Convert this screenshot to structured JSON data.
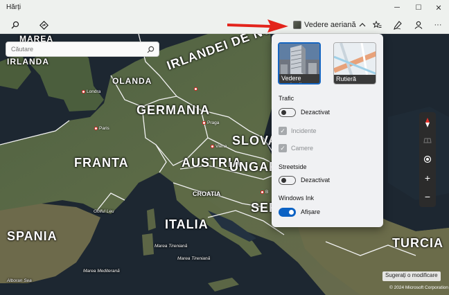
{
  "app": {
    "title": "Hărți"
  },
  "window": {
    "minimize": "─",
    "maximize": "☐",
    "close": "✕"
  },
  "toolbar": {
    "search_icon": "search-icon",
    "directions_icon": "directions-icon",
    "map_style_label": "Vedere aeriană",
    "favorites_icon": "favorites-icon",
    "ink_icon": "pen-icon",
    "account_icon": "person-icon",
    "more_label": "···"
  },
  "search": {
    "placeholder": "Căutare"
  },
  "map": {
    "countries": [
      "GERMANIA",
      "FRANTA",
      "ITALIA",
      "SPANIA",
      "AUSTRIA",
      "UNGARIA",
      "SLOVACIA",
      "CROATIA",
      "SERBIA",
      "TURCIA",
      "OLANDA",
      "IRLANDA",
      "MAREA NORDULUI",
      "MAREA IRLANDEI DE NORD"
    ],
    "countries_text": {
      "germania": "GERMANIA",
      "franta": "FRANTA",
      "italia": "ITALIA",
      "spania": "SPANIA",
      "austria": "AUSTRIA",
      "ungaria": "UNGARIA",
      "slovacia": "SLOVAC",
      "croatia": "CROATIA",
      "serbia": "SER",
      "turcia": "TURCIA",
      "olanda": "OLANDA",
      "irlanda": "IRLANDA",
      "marea_nordului": "MAREA",
      "irlandei_de_nord": "IRLANDEI DE NORD"
    },
    "cities": {
      "londra": "Londra",
      "paris": "Paris",
      "praga": "Praga",
      "viena": "Viena",
      "b": "B"
    },
    "seas": {
      "tirenian1": "Marea Tireniană",
      "tirenian2": "Marea Tireniană",
      "mediterana": "Marea Mediterană",
      "leu": "Golful Leu",
      "alboran": "Alboran Sea"
    }
  },
  "flyout": {
    "tiles": {
      "aerial": "Vedere aeriană",
      "road": "Rutieră"
    },
    "traffic": {
      "title": "Trafic",
      "toggle": "Dezactivat",
      "incidents": "Incidente",
      "cameras": "Camere"
    },
    "streetside": {
      "title": "Streetside",
      "toggle": "Dezactivat"
    },
    "ink": {
      "title": "Windows Ink",
      "toggle": "Afișare"
    }
  },
  "controls": {
    "compass": "compass-icon",
    "tilt": "tilt-icon",
    "locate": "locate-icon",
    "zoom_in": "+",
    "zoom_out": "−"
  },
  "footer": {
    "suggest": "Sugerați o modificare",
    "copyright": "© 2024 Microsoft Corporation"
  },
  "colors": {
    "accent": "#0b62c4",
    "annotation_arrow": "#e3241b"
  }
}
